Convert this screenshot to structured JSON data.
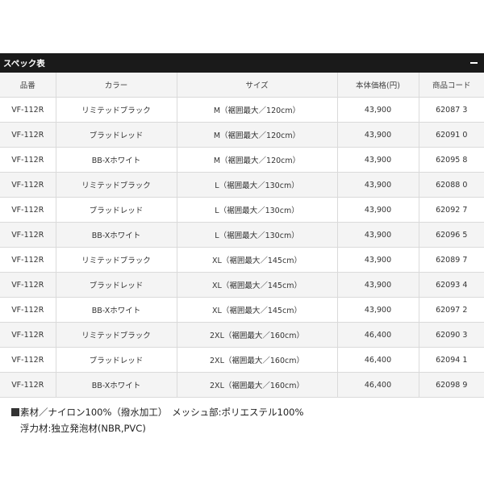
{
  "spec_table": {
    "title": "スペック表",
    "columns": [
      "品番",
      "カラー",
      "サイズ",
      "本体価格(円)",
      "商品コード"
    ],
    "rows": [
      [
        "VF-112R",
        "リミテッドブラック",
        "M（裾囲最大／120cm）",
        "43,900",
        "62087 3"
      ],
      [
        "VF-112R",
        "ブラッドレッド",
        "M（裾囲最大／120cm）",
        "43,900",
        "62091 0"
      ],
      [
        "VF-112R",
        "BB-Xホワイト",
        "M（裾囲最大／120cm）",
        "43,900",
        "62095 8"
      ],
      [
        "VF-112R",
        "リミテッドブラック",
        "L（裾囲最大／130cm）",
        "43,900",
        "62088 0"
      ],
      [
        "VF-112R",
        "ブラッドレッド",
        "L（裾囲最大／130cm）",
        "43,900",
        "62092 7"
      ],
      [
        "VF-112R",
        "BB-Xホワイト",
        "L（裾囲最大／130cm）",
        "43,900",
        "62096 5"
      ],
      [
        "VF-112R",
        "リミテッドブラック",
        "XL（裾囲最大／145cm）",
        "43,900",
        "62089 7"
      ],
      [
        "VF-112R",
        "ブラッドレッド",
        "XL（裾囲最大／145cm）",
        "43,900",
        "62093 4"
      ],
      [
        "VF-112R",
        "BB-Xホワイト",
        "XL（裾囲最大／145cm）",
        "43,900",
        "62097 2"
      ],
      [
        "VF-112R",
        "リミテッドブラック",
        "2XL（裾囲最大／160cm）",
        "46,400",
        "62090 3"
      ],
      [
        "VF-112R",
        "ブラッドレッド",
        "2XL（裾囲最大／160cm）",
        "46,400",
        "62094 1"
      ],
      [
        "VF-112R",
        "BB-Xホワイト",
        "2XL（裾囲最大／160cm）",
        "46,400",
        "62098 9"
      ]
    ]
  },
  "notes": {
    "material": "素材／ナイロン100%（撥水加工）　メッシュ部:ポリエステル100%",
    "float": "浮力材:独立発泡材(NBR,PVC)"
  },
  "colors": {
    "header_bg": "#1a1a1a",
    "stripe_bg": "#f4f4f4",
    "border": "#dadada"
  }
}
